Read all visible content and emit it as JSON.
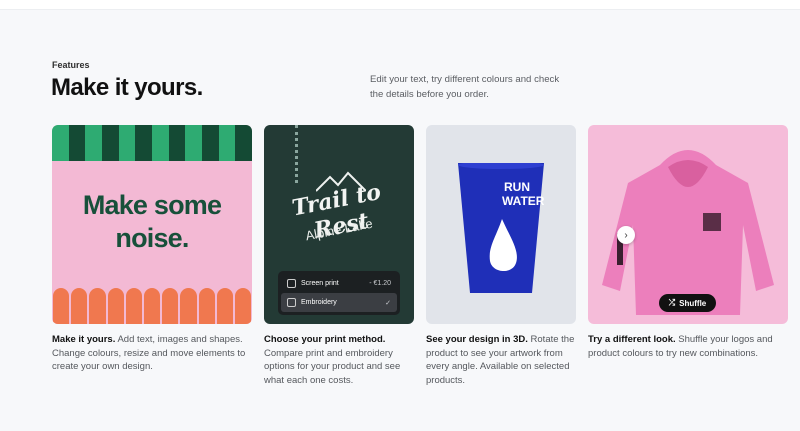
{
  "section": {
    "eyebrow": "Features",
    "title": "Make it yours.",
    "intro": "Edit your text, try different colours and check the details before you order."
  },
  "cards": [
    {
      "image_text": [
        "Make some",
        "noise."
      ],
      "caption_bold": "Make it yours.",
      "caption": " Add text, images and shapes. Change colours, resize and move elements to create your own design."
    },
    {
      "embroidery_text": [
        "Trail to Rest",
        "Alpine Lake"
      ],
      "options": [
        {
          "label": "Screen print",
          "price": "- €1.20",
          "icon": "print-icon"
        },
        {
          "label": "Embroidery",
          "check": "✓",
          "icon": "embroidery-icon"
        }
      ],
      "caption_bold": "Choose your print method.",
      "caption": " Compare print and embroidery options for your product and see what each one costs."
    },
    {
      "cup_text": [
        "RUN",
        "WATER"
      ],
      "caption_bold": "See your design in 3D.",
      "caption": " Rotate the product to see your artwork from every angle. Available on selected products."
    },
    {
      "shuffle_label": "Shuffle",
      "arrow": "›",
      "caption_bold": "Try a different look.",
      "caption": " Shuffle your logos and product colours to try new combinations."
    }
  ],
  "colors": {
    "accent_green": "#17503a",
    "pink": "#f3b9d4",
    "orange": "#f0784f",
    "cup_blue": "#1f2fb8",
    "hoodie_pink": "#ec7fbc"
  }
}
